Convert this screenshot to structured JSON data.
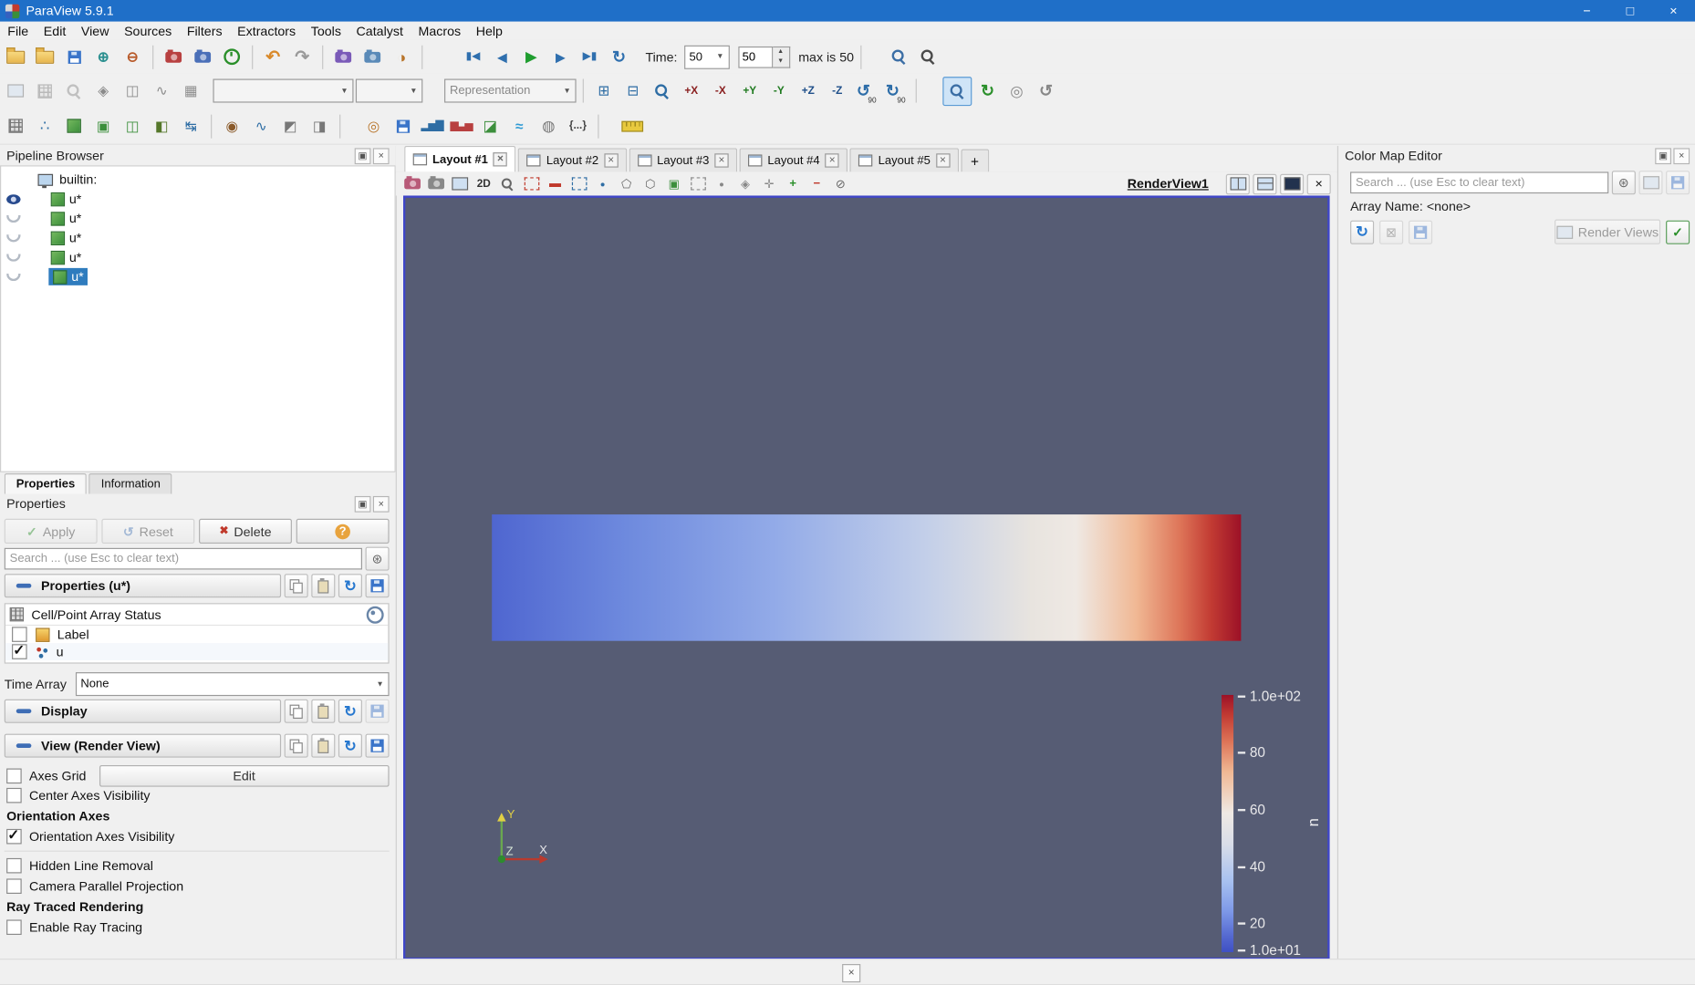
{
  "window": {
    "title": "ParaView 5.9.1"
  },
  "menubar": {
    "items": [
      "File",
      "Edit",
      "View",
      "Sources",
      "Filters",
      "Extractors",
      "Tools",
      "Catalyst",
      "Macros",
      "Help"
    ]
  },
  "toolbar": {
    "time_label": "Time:",
    "time_select": "50",
    "frame_value": "50",
    "max_label": "max is 50",
    "representation_value": "Representation",
    "axis_buttons": [
      "+X",
      "-X",
      "+Y",
      "-Y",
      "+Z",
      "-Z"
    ],
    "rotate_ccw_label": "90",
    "rotate_cw_label": "90"
  },
  "pipeline_browser": {
    "title": "Pipeline Browser",
    "root_label": "builtin:",
    "items": [
      {
        "label": "u*",
        "visible": true,
        "selected": false
      },
      {
        "label": "u*",
        "visible": false,
        "selected": false
      },
      {
        "label": "u*",
        "visible": false,
        "selected": false
      },
      {
        "label": "u*",
        "visible": false,
        "selected": false
      },
      {
        "label": "u*",
        "visible": false,
        "selected": true
      }
    ]
  },
  "dock_tabs": {
    "properties": "Properties",
    "information": "Information"
  },
  "properties_panel": {
    "title": "Properties",
    "apply_label": "Apply",
    "reset_label": "Reset",
    "delete_label": "Delete",
    "help_label": "?",
    "search_placeholder": "Search ... (use Esc to clear text)",
    "section_properties_title": "Properties (u*)",
    "array_status_title": "Cell/Point Array Status",
    "array_rows": [
      {
        "label": "Label",
        "checked": false
      },
      {
        "label": "u",
        "checked": true
      }
    ],
    "time_array_label": "Time Array",
    "time_array_value": "None",
    "section_display_title": "Display",
    "section_view_title": "View (Render View)",
    "axes_grid_label": "Axes Grid",
    "axes_grid_checked": false,
    "edit_button_label": "Edit",
    "center_axes_label": "Center Axes Visibility",
    "center_axes_checked": false,
    "orientation_header": "Orientation Axes",
    "orientation_visibility_label": "Orientation Axes Visibility",
    "orientation_visibility_checked": true,
    "hidden_line_label": "Hidden Line Removal",
    "hidden_line_checked": false,
    "camera_parallel_label": "Camera Parallel Projection",
    "camera_parallel_checked": false,
    "raytrace_header": "Ray Traced Rendering",
    "enable_raytrace_label": "Enable Ray Tracing",
    "enable_raytrace_checked": false
  },
  "layout_bar": {
    "tabs": [
      "Layout #1",
      "Layout #2",
      "Layout #3",
      "Layout #4",
      "Layout #5"
    ],
    "add_label": "+"
  },
  "view_toolbar": {
    "mode_2d_label": "2D",
    "view_name": "RenderView1"
  },
  "render_view": {
    "legend": {
      "title": "u",
      "max_label": "1.0e+02",
      "tick_labels": [
        "80",
        "60",
        "40",
        "20"
      ],
      "min_label": "1.0e+01",
      "range": [
        10,
        100
      ]
    },
    "axes": {
      "x": "X",
      "y": "Y",
      "z": "Z"
    }
  },
  "color_map_editor": {
    "title": "Color Map Editor",
    "search_placeholder": "Search ... (use Esc to clear text)",
    "array_name_label": "Array Name: <none>",
    "render_views_label": "Render Views"
  },
  "colors": {
    "titlebar": "#1f6fc8",
    "selection": "#2f7cbe",
    "view_background": "#565c74",
    "view_border": "#3f46c8",
    "legend_top": "#9c1127",
    "legend_bottom": "#3f50c4"
  }
}
